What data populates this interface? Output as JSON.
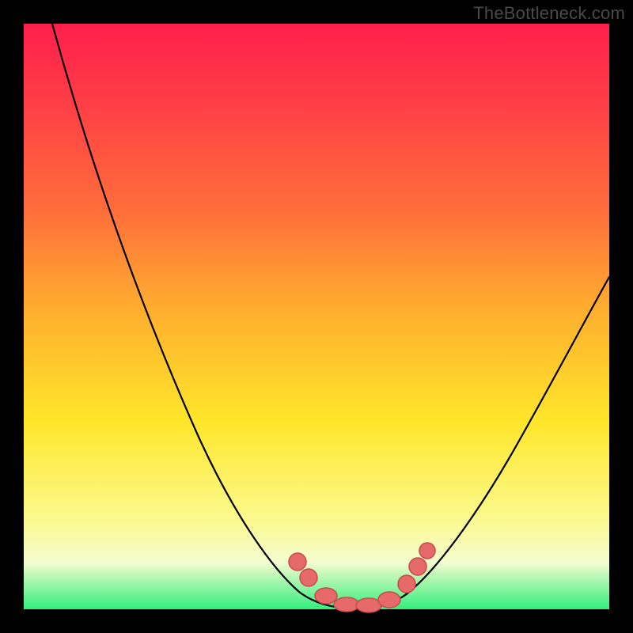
{
  "watermark": "TheBottleneck.com",
  "colors": {
    "frame": "#000000",
    "gradient_top": "#ff1f4b",
    "gradient_mid": "#ffe62a",
    "gradient_bottom": "#33ef7e",
    "curve": "#000000",
    "marker_fill": "#e66a6a",
    "marker_stroke": "#ca4a4a"
  },
  "chart_data": {
    "type": "line",
    "title": "",
    "xlabel": "",
    "ylabel": "",
    "xlim": [
      0,
      100
    ],
    "ylim": [
      0,
      100
    ],
    "grid": false,
    "legend": false,
    "series": [
      {
        "name": "bottleneck-curve",
        "x": [
          5,
          10,
          15,
          20,
          25,
          30,
          35,
          40,
          44,
          47,
          50,
          53,
          56,
          59,
          62,
          66,
          70,
          75,
          80,
          85,
          90,
          95,
          100
        ],
        "y": [
          100,
          90,
          79,
          68,
          56,
          45,
          34,
          23,
          13,
          7,
          3,
          1,
          0,
          0,
          1,
          4,
          9,
          16,
          24,
          32,
          40,
          48,
          56
        ]
      }
    ],
    "markers": [
      {
        "x": 46,
        "y": 8
      },
      {
        "x": 48,
        "y": 5
      },
      {
        "x": 51,
        "y": 2
      },
      {
        "x": 54,
        "y": 0.5
      },
      {
        "x": 57,
        "y": 0
      },
      {
        "x": 60,
        "y": 0.5
      },
      {
        "x": 63,
        "y": 2
      },
      {
        "x": 66,
        "y": 5
      },
      {
        "x": 68,
        "y": 8
      }
    ]
  }
}
